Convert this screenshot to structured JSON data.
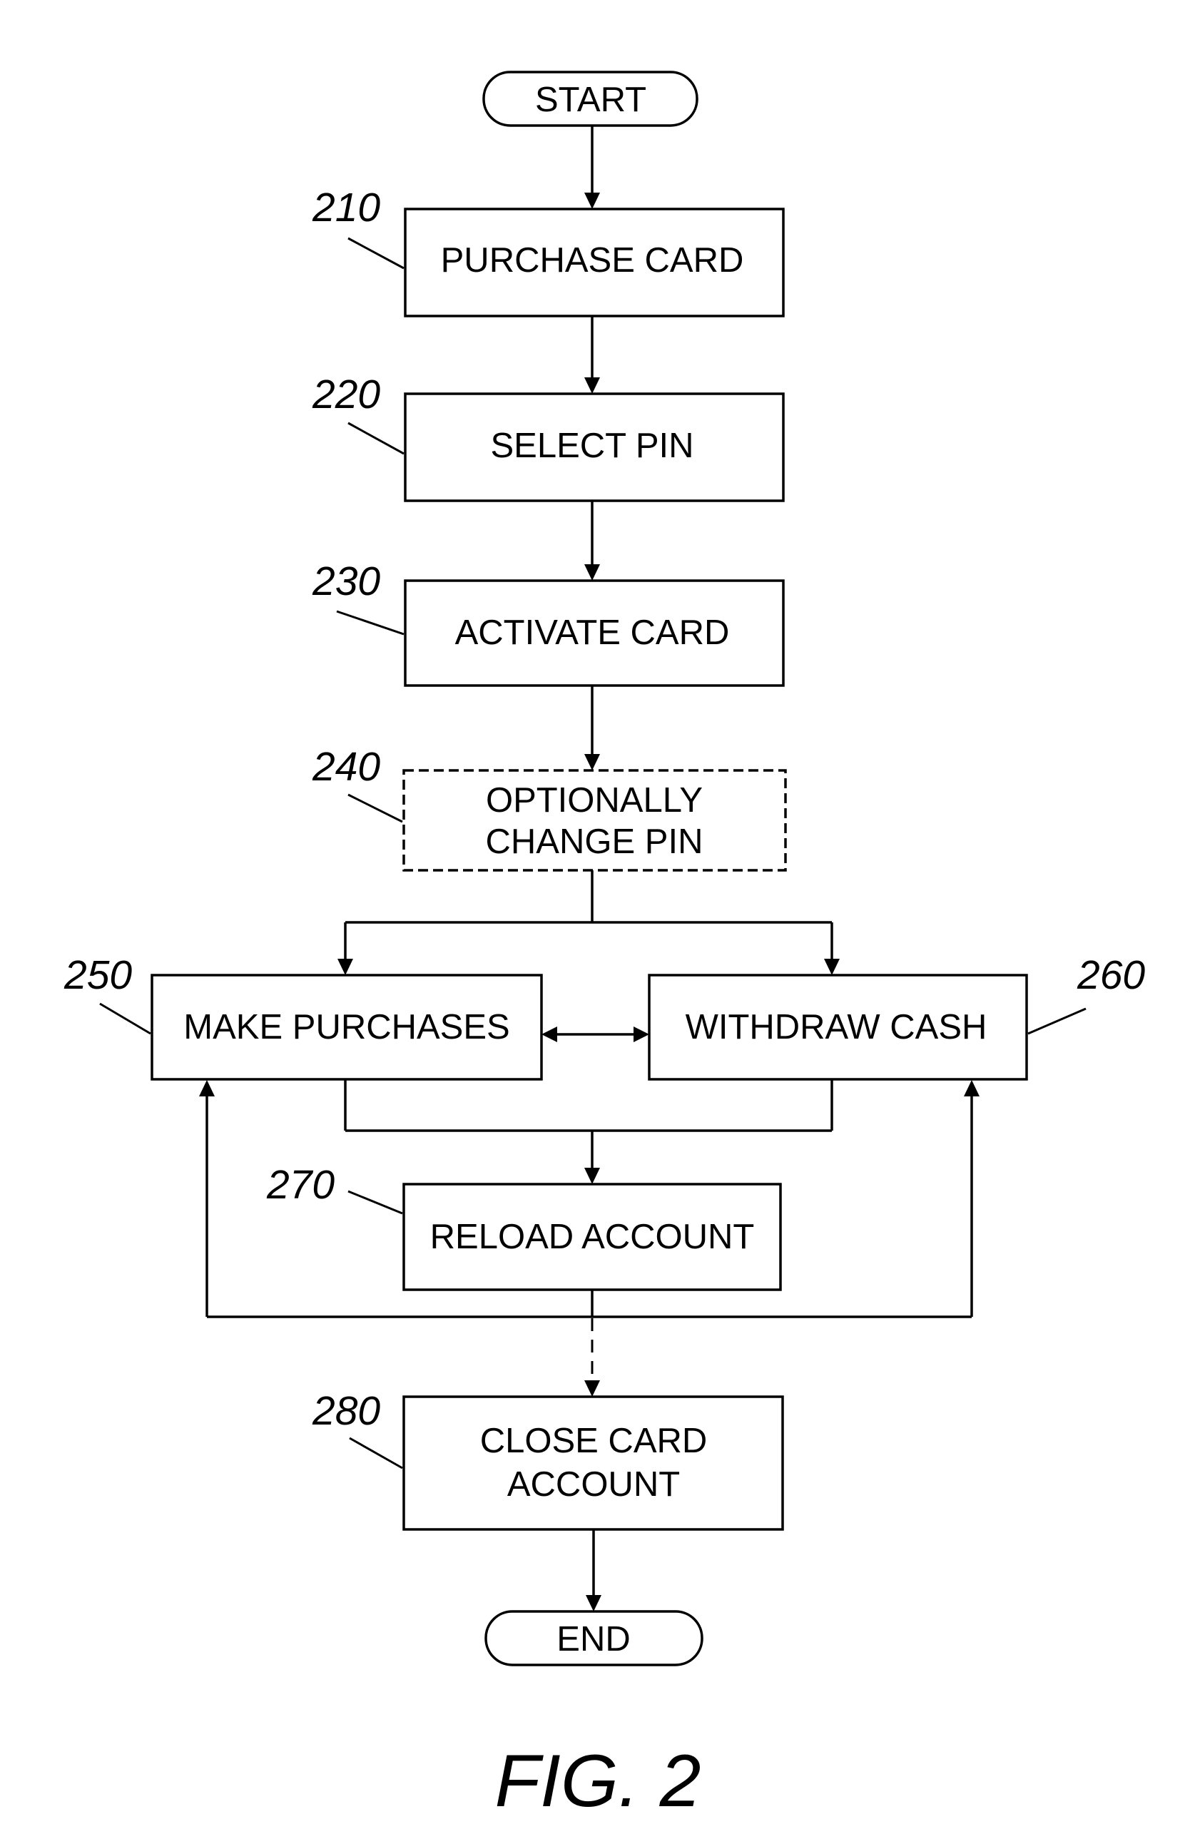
{
  "figure": {
    "caption": "FIG. 2"
  },
  "terminals": {
    "start": "START",
    "end": "END"
  },
  "steps": [
    {
      "ref": "210",
      "lines": [
        "PURCHASE CARD"
      ],
      "optional": false
    },
    {
      "ref": "220",
      "lines": [
        "SELECT PIN"
      ],
      "optional": false
    },
    {
      "ref": "230",
      "lines": [
        "ACTIVATE CARD"
      ],
      "optional": false
    },
    {
      "ref": "240",
      "lines": [
        "OPTIONALLY",
        "CHANGE PIN"
      ],
      "optional": true
    },
    {
      "ref": "250",
      "lines": [
        "MAKE PURCHASES"
      ],
      "optional": false
    },
    {
      "ref": "260",
      "lines": [
        "WITHDRAW CASH"
      ],
      "optional": false
    },
    {
      "ref": "270",
      "lines": [
        "RELOAD ACCOUNT"
      ],
      "optional": false
    },
    {
      "ref": "280",
      "lines": [
        "CLOSE CARD",
        "ACCOUNT"
      ],
      "optional": false
    }
  ],
  "connections": [
    {
      "from": "START",
      "to": "210",
      "style": "solid"
    },
    {
      "from": "210",
      "to": "220",
      "style": "solid"
    },
    {
      "from": "220",
      "to": "230",
      "style": "solid"
    },
    {
      "from": "230",
      "to": "240",
      "style": "solid"
    },
    {
      "from": "240",
      "to": "250",
      "style": "solid"
    },
    {
      "from": "240",
      "to": "260",
      "style": "solid"
    },
    {
      "from": "250",
      "to": "260",
      "style": "solid",
      "bidirectional": true
    },
    {
      "from": "250",
      "to": "270",
      "style": "solid"
    },
    {
      "from": "260",
      "to": "270",
      "style": "solid"
    },
    {
      "from": "270",
      "to": "250",
      "style": "solid"
    },
    {
      "from": "270",
      "to": "260",
      "style": "solid"
    },
    {
      "from": "270",
      "to": "280",
      "style": "dashed"
    },
    {
      "from": "280",
      "to": "END",
      "style": "solid"
    }
  ]
}
